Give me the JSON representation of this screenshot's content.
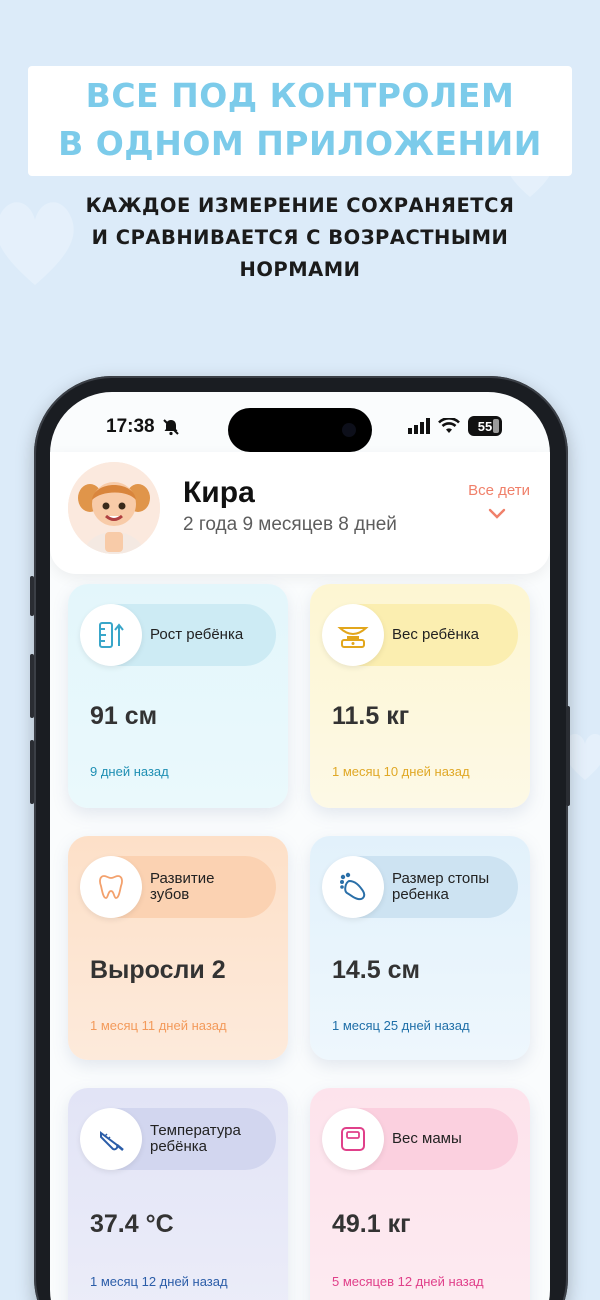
{
  "promo": {
    "headline_line1": "ВСЕ ПОД КОНТРОЛЕМ",
    "headline_line2": "В ОДНОМ ПРИЛОЖЕНИИ",
    "subline_line1": "КАЖДОЕ ИЗМЕРЕНИЕ СОХРАНЯЕТСЯ",
    "subline_line2": "И СРАВНИВАЕТСЯ С ВОЗРАСТНЫМИ",
    "subline_line3": "НОРМАМИ"
  },
  "status_bar": {
    "time": "17:38",
    "battery": "55"
  },
  "header": {
    "child_name": "Кира",
    "child_age": "2 года 9 месяцев 8 дней",
    "all_kids_label": "Все дети"
  },
  "cards": [
    {
      "icon": "ruler-icon",
      "label": "Рост ребёнка",
      "value": "91 см",
      "date": "9 дней назад"
    },
    {
      "icon": "scale-icon",
      "label": "Вес ребёнка",
      "value": "11.5 кг",
      "date": "1 месяц 10 дней назад"
    },
    {
      "icon": "tooth-icon",
      "label_line1": "Развитие",
      "label_line2": "зубов",
      "value": "Выросли 2",
      "date": "1 месяц 11 дней назад"
    },
    {
      "icon": "foot-icon",
      "label_line1": "Размер стопы",
      "label_line2": "ребенка",
      "value": "14.5 см",
      "date": "1 месяц 25 дней назад"
    },
    {
      "icon": "thermometer-icon",
      "label_line1": "Температура",
      "label_line2": "ребёнка",
      "value": "37.4 °C",
      "date": "1 месяц 12 дней назад"
    },
    {
      "icon": "bathroom-scale-icon",
      "label": "Вес мамы",
      "value": "49.1 кг",
      "date": "5 месяцев 12 дней назад"
    }
  ],
  "colors": {
    "headline": "#7ccbea",
    "accent_orange": "#f0806a",
    "height_date": "#1f8fb3",
    "weight_date": "#e0a826",
    "teeth_date": "#f39a5b",
    "foot_date": "#1f6fa8",
    "temp_date": "#2b5da8",
    "mom_date": "#e0408a"
  }
}
